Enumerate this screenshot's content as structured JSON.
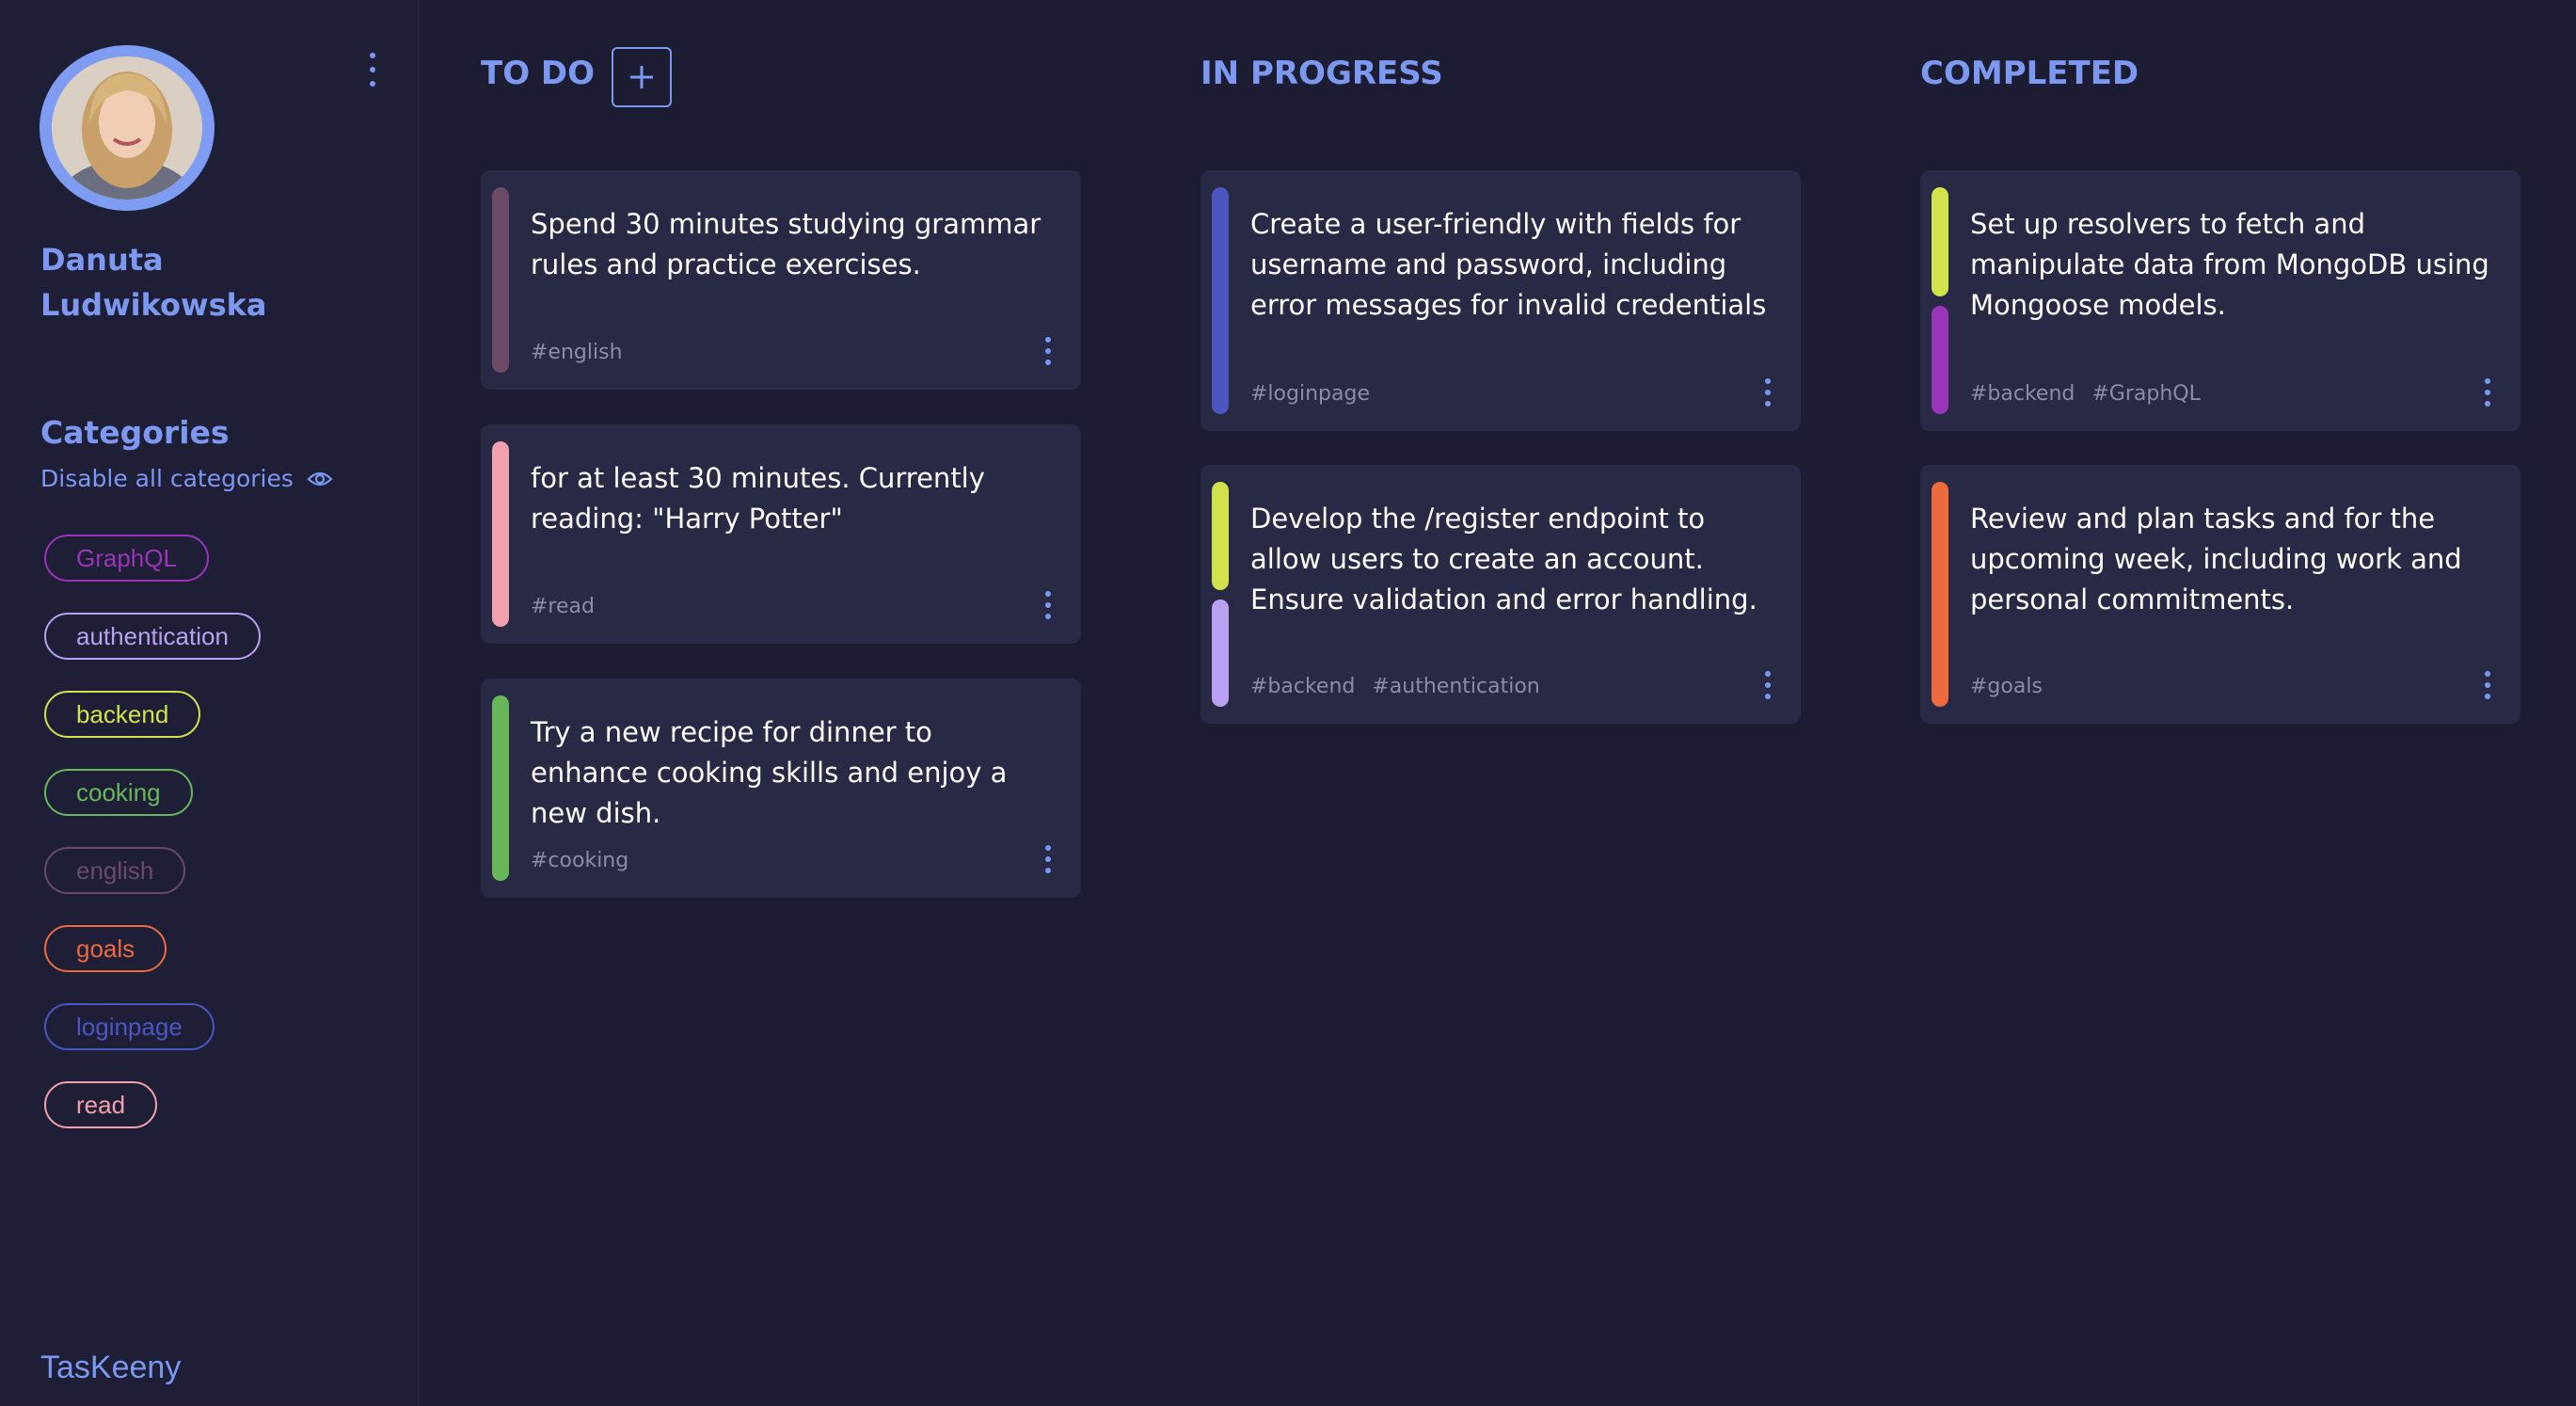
{
  "user": {
    "name": "Danuta Ludwikowska"
  },
  "sidebar": {
    "categories_title": "Categories",
    "disable_all_label": "Disable all categories",
    "categories": [
      {
        "label": "GraphQL",
        "color": "#9a34b8"
      },
      {
        "label": "authentication",
        "color": "#b9a0f0"
      },
      {
        "label": "backend",
        "color": "#d2e24a"
      },
      {
        "label": "cooking",
        "color": "#68b85a"
      },
      {
        "label": "english",
        "color": "#6a4a66"
      },
      {
        "label": "goals",
        "color": "#ec6a3c"
      },
      {
        "label": "loginpage",
        "color": "#4b56c0"
      },
      {
        "label": "read",
        "color": "#f2a0ac"
      }
    ],
    "brand": "TasKeeny"
  },
  "columns": [
    {
      "title": "TO DO",
      "cards": [
        {
          "text": "Spend 30 minutes studying grammar rules and practice exercises.",
          "tags": [
            "#english"
          ],
          "colors": [
            "#6a4a66"
          ]
        },
        {
          "text": "for at least 30 minutes. Currently reading: \"Harry Potter\"",
          "tags": [
            "#read"
          ],
          "colors": [
            "#f2a0ac"
          ]
        },
        {
          "text": "Try a new recipe for dinner to enhance cooking skills and enjoy a new dish.",
          "tags": [
            "#cooking"
          ],
          "colors": [
            "#68b85a"
          ]
        }
      ]
    },
    {
      "title": "IN PROGRESS",
      "cards": [
        {
          "text": "Create a user-friendly with fields for username and password, including error messages for invalid credentials",
          "tags": [
            "#loginpage"
          ],
          "colors": [
            "#4b56c0"
          ]
        },
        {
          "text": "Develop the /register endpoint to allow users to create an account. Ensure validation and error handling.",
          "tags": [
            "#backend",
            "#authentication"
          ],
          "colors": [
            "#d2e24a",
            "#b9a0f0"
          ]
        }
      ]
    },
    {
      "title": "COMPLETED",
      "cards": [
        {
          "text": "Set up resolvers to fetch and manipulate data from MongoDB using Mongoose models.",
          "tags": [
            "#backend",
            "#GraphQL"
          ],
          "colors": [
            "#d2e24a",
            "#9a34b8"
          ]
        },
        {
          "text": "Review and plan tasks and for the upcoming week, including work and personal commitments.",
          "tags": [
            "#goals"
          ],
          "colors": [
            "#ec6a3c"
          ]
        }
      ]
    }
  ]
}
